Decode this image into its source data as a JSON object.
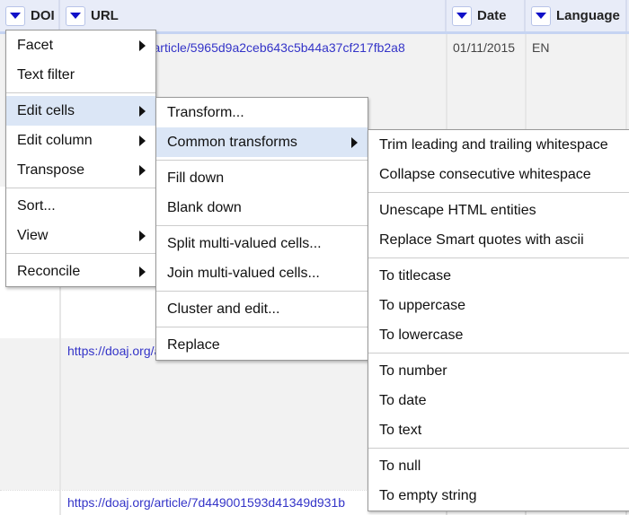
{
  "columns": [
    {
      "label": "DOI"
    },
    {
      "label": "URL"
    },
    {
      "label": "Date"
    },
    {
      "label": "Language"
    }
  ],
  "rows": [
    {
      "url": "https://doaj.org/article/5965d9a2ceb643c5b44a37cf217fb2a8",
      "date": "01/11/2015",
      "language": "EN"
    },
    {
      "url": "",
      "date": "",
      "language": ""
    },
    {
      "url": "https://doaj.org/article/",
      "date": "",
      "language": ""
    },
    {
      "url": "https://doaj.org/article/7d449001593d41349d931b",
      "date": "",
      "language": ""
    }
  ],
  "menu1": {
    "items": [
      {
        "label": "Facet",
        "sub": true
      },
      {
        "label": "Text filter"
      },
      {
        "sep": true
      },
      {
        "label": "Edit cells",
        "sub": true,
        "active": true
      },
      {
        "label": "Edit column",
        "sub": true
      },
      {
        "label": "Transpose",
        "sub": true
      },
      {
        "sep": true
      },
      {
        "label": "Sort..."
      },
      {
        "label": "View",
        "sub": true
      },
      {
        "sep": true
      },
      {
        "label": "Reconcile",
        "sub": true
      }
    ]
  },
  "menu2": {
    "items": [
      {
        "label": "Transform..."
      },
      {
        "label": "Common transforms",
        "sub": true,
        "active": true
      },
      {
        "sep": true
      },
      {
        "label": "Fill down"
      },
      {
        "label": "Blank down"
      },
      {
        "sep": true
      },
      {
        "label": "Split multi-valued cells..."
      },
      {
        "label": "Join multi-valued cells..."
      },
      {
        "sep": true
      },
      {
        "label": "Cluster and edit..."
      },
      {
        "sep": true
      },
      {
        "label": "Replace"
      }
    ]
  },
  "menu3": {
    "items": [
      {
        "label": "Trim leading and trailing whitespace"
      },
      {
        "label": "Collapse consecutive whitespace"
      },
      {
        "sep": true
      },
      {
        "label": "Unescape HTML entities"
      },
      {
        "label": "Replace Smart quotes with ascii"
      },
      {
        "sep": true
      },
      {
        "label": "To titlecase"
      },
      {
        "label": "To uppercase"
      },
      {
        "label": "To lowercase"
      },
      {
        "sep": true
      },
      {
        "label": "To number"
      },
      {
        "label": "To date"
      },
      {
        "label": "To text"
      },
      {
        "sep": true
      },
      {
        "label": "To null"
      },
      {
        "label": "To empty string"
      }
    ]
  }
}
